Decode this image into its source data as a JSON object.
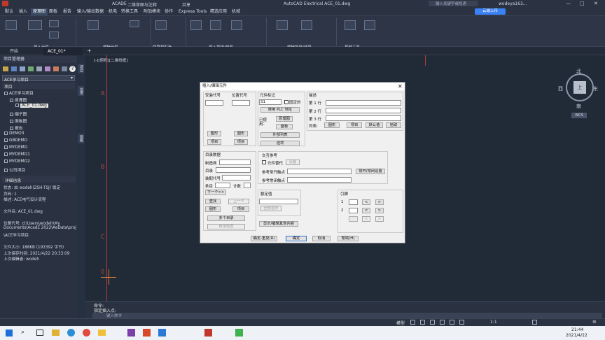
{
  "titlebar": {
    "app": "ACADE",
    "workspace": "二维草图与注释",
    "share": "共享",
    "title": "AutoCAD Electrical  ACE_01.dwg",
    "search_placeholder": "输入关键字或短语",
    "user": "wodeya163..."
  },
  "menubar": {
    "tabs": [
      "默认",
      "插入",
      "原理图",
      "面板",
      "报告",
      "输入/输出数据",
      "机电",
      "转换工具",
      "附加模块",
      "协作",
      "Express Tools",
      "精选应用",
      "机械"
    ],
    "active": "原理图",
    "cloud_button": "云端上传"
  },
  "ribbon": {
    "groups": [
      "插入元件",
      "编辑元件",
      "回路剪贴板",
      "插入导线/线号",
      "编辑导线/线号",
      "其他工具"
    ]
  },
  "doctabs": {
    "start": "开始",
    "current": "ACE_01*"
  },
  "viewport_label": "[-][俯视][二维线框]",
  "project_manager": {
    "title": "项目管理器",
    "dropdown": "ACE学习项目",
    "section": "项目",
    "tree": [
      {
        "label": "ACE学习项目",
        "level": 0
      },
      {
        "label": "原理图",
        "level": 1
      },
      {
        "label": "ACE_01.dwg",
        "level": 2,
        "selected": true
      },
      {
        "label": "端子图",
        "level": 1
      },
      {
        "label": "面板图",
        "level": 1
      },
      {
        "label": "报告",
        "level": 1
      },
      {
        "label": "DEMO3",
        "level": 0
      },
      {
        "label": "GBDEMO",
        "level": 0
      },
      {
        "label": "MYDEMO",
        "level": 0
      },
      {
        "label": "MYDEMO1",
        "level": 0
      },
      {
        "label": "MYDEMO2",
        "level": 0
      },
      {
        "label": "公司项目",
        "level": 0
      }
    ],
    "details_title": "详细信息",
    "details": [
      "状态: 由 wodeh(ZSH-TSJ) 锁定",
      "页码: 1",
      "描述: ACE电气设计流程",
      "",
      "文件名: ACE_01.dwg",
      "",
      "位置代号: d:\\Users\\wodeh\\My",
      "Documents\\AcadE 2022\\AeData\\proj",
      "\\ACE学习项目",
      "",
      "文件大小: 188KB (193392 字节)",
      "上次保存时间: 2021/4/22 20:33:09",
      "上次编辑者: wodeh"
    ]
  },
  "vtabs": [
    "项目",
    "位置",
    "面板"
  ],
  "ladder": {
    "labels": [
      "A",
      "B",
      "C"
    ],
    "rung": "0"
  },
  "viewcube": {
    "north": "北",
    "south": "南",
    "east": "东",
    "west": "西",
    "top": "上",
    "wcs": "WCS"
  },
  "dialog": {
    "title": "插入/编辑元件",
    "install_code": "安装代号",
    "location_code": "位置代号",
    "drawing_btn": "图形",
    "project_btn": "项目",
    "tag_title": "元件标记",
    "tag_value": "S1",
    "fixed": "固定的",
    "use_plc": "使用 PLC 地址",
    "used_label": "已使用：",
    "schematic_btn": "原理图",
    "panel_btn": "面板",
    "external_list": "外部列表",
    "options": "选项",
    "desc_title": "描述",
    "lines": [
      "第 1 行",
      "第 2 行",
      "第 3 行"
    ],
    "list_label": "列表:",
    "desc_buttons": [
      "图形",
      "项目",
      "默认值",
      "拾取"
    ],
    "catalog_title": "目录数据",
    "manufacturer": "制造商",
    "catalog": "目录",
    "assembly": "装配代号",
    "item": "条目",
    "count": "计数",
    "next": "下一个>>",
    "lookup": "查找",
    "previous": "上一个",
    "drawing2": "图形",
    "project2": "项目",
    "multi_catalog": "多个目录",
    "catalog_check": "目录检查",
    "xref_title": "交互参考",
    "component_override": "元件替代",
    "setup": "设置",
    "ref_no": "参考常开触点",
    "ref_nc": "参考常闭触点",
    "no_nc_setup": "常开/常闭设置",
    "rating_title": "额定值",
    "show_all": "全部显示",
    "show_edit": "显示/编辑其他内容",
    "pins_title": "引脚",
    "pins": [
      "1",
      "2"
    ],
    "ok_repeat": "确定-重复(R)",
    "ok": "确定",
    "cancel": "取消",
    "help": "帮助(H)"
  },
  "command": {
    "line1": "命令:",
    "line2": "指定插入点:",
    "input_placeholder": "键入命令"
  },
  "statusbar": {
    "model": "模型",
    "scale": "1:1"
  },
  "taskbar": {
    "time": "21:44",
    "date": "2021/4/22"
  }
}
